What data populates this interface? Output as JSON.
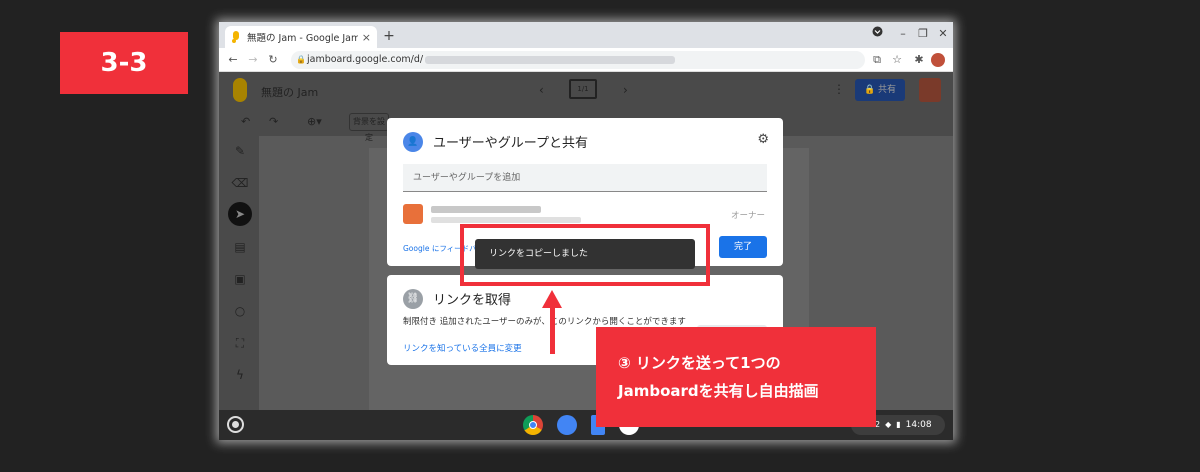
{
  "badge": {
    "label": "3-3"
  },
  "browser": {
    "tab_title": "無題の Jam - Google Jamboard",
    "tab_close": "×",
    "new_tab": "+",
    "url": "jamboard.google.com/d/"
  },
  "app": {
    "jam_title": "無題の Jam",
    "frame_counter": "1/1",
    "share_label": "🔒 共有",
    "background_label": "背景を設定"
  },
  "share_dialog": {
    "title": "ユーザーやグループと共有",
    "input_placeholder": "ユーザーやグループを追加",
    "owner_label": "オーナー",
    "feedback_link": "Google にフィードバックを送信",
    "done_button": "完了"
  },
  "link_dialog": {
    "title": "リンクを取得",
    "description": "制限付き 追加されたユーザーのみが、このリンクから開くことができます",
    "change_link": "リンクを知っている全員に変更"
  },
  "toast": {
    "message": "リンクをコピーしました"
  },
  "shelf": {
    "time": "14:08",
    "notification_count": "2"
  },
  "callout": {
    "line1": "③ リンクを送って1つの",
    "line2": "Jamboardを共有し自由描画"
  },
  "colors": {
    "accent_red": "#f0303a",
    "google_blue": "#1a73e8"
  }
}
